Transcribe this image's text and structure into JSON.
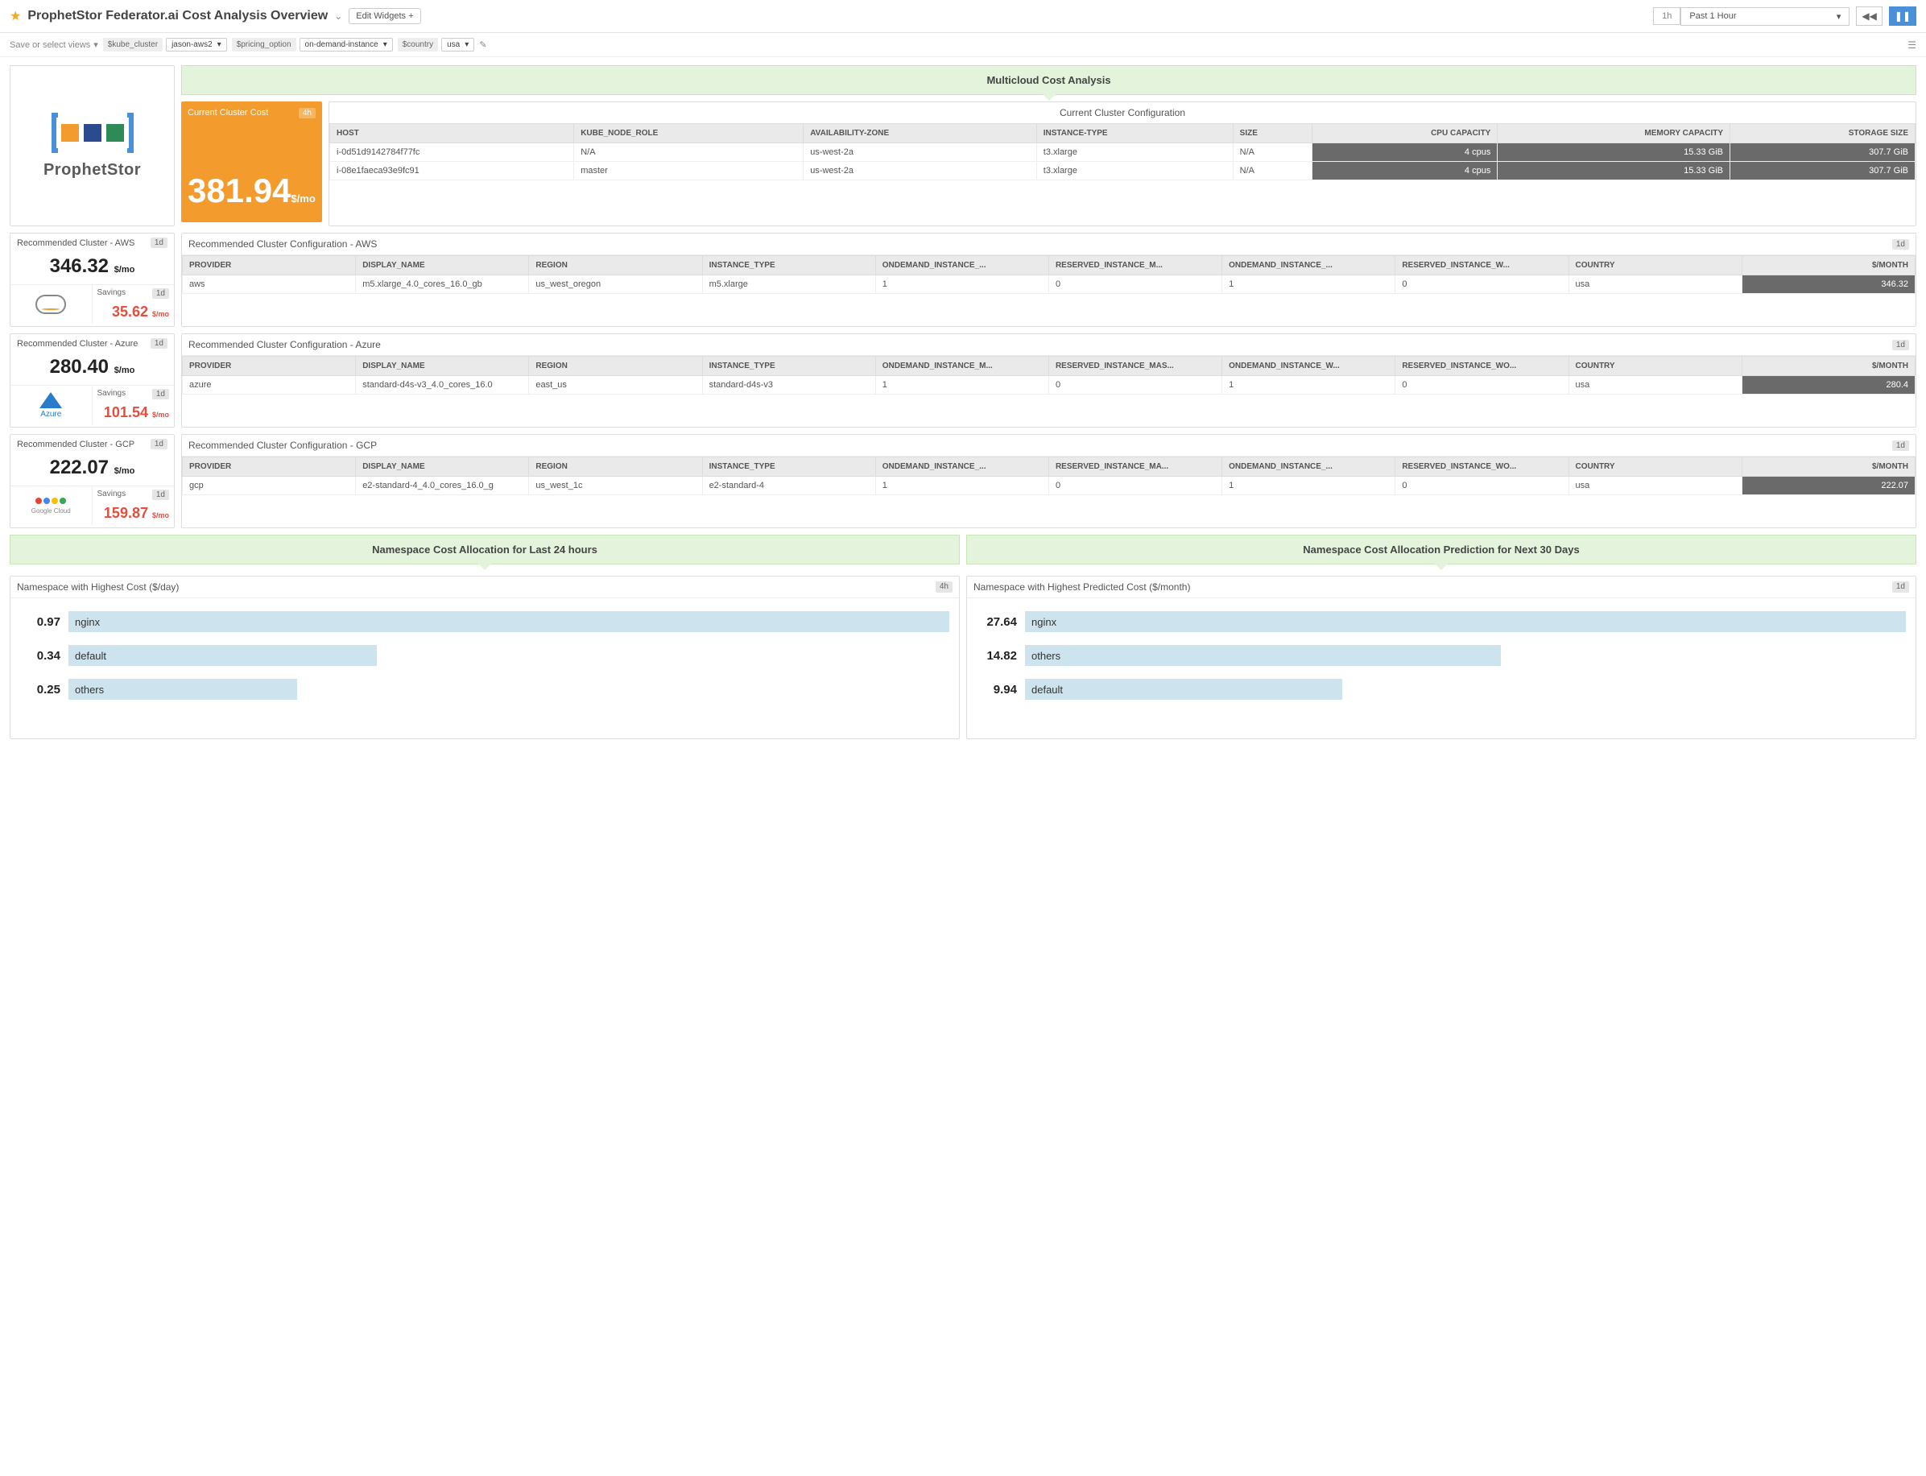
{
  "header": {
    "title": "ProphetStor Federator.ai Cost Analysis Overview",
    "edit_widgets": "Edit Widgets",
    "time_short": "1h",
    "time_label": "Past 1 Hour"
  },
  "subbar": {
    "views": "Save or select views",
    "vars": [
      {
        "name": "$kube_cluster",
        "value": "jason-aws2"
      },
      {
        "name": "$pricing_option",
        "value": "on-demand-instance"
      },
      {
        "name": "$country",
        "value": "usa"
      }
    ]
  },
  "logo_text": "ProphetStor",
  "multicloud_banner": "Multicloud Cost Analysis",
  "current_cost": {
    "title": "Current Cluster Cost",
    "badge": "4h",
    "value": "381.94",
    "unit": "$/mo"
  },
  "current_config": {
    "title": "Current Cluster Configuration",
    "headers": [
      "HOST",
      "KUBE_NODE_ROLE",
      "AVAILABILITY-ZONE",
      "INSTANCE-TYPE",
      "SIZE",
      "CPU CAPACITY",
      "MEMORY CAPACITY",
      "STORAGE SIZE"
    ],
    "rows": [
      [
        "i-0d51d9142784f77fc",
        "N/A",
        "us-west-2a",
        "t3.xlarge",
        "N/A",
        "4 cpus",
        "15.33 GiB",
        "307.7 GiB"
      ],
      [
        "i-08e1faeca93e9fc91",
        "master",
        "us-west-2a",
        "t3.xlarge",
        "N/A",
        "4 cpus",
        "15.33 GiB",
        "307.7 GiB"
      ]
    ]
  },
  "recs": [
    {
      "provider": "AWS",
      "left_title": "Recommended Cluster - AWS",
      "badge": "1d",
      "value": "346.32",
      "unit": "$/mo",
      "savings_label": "Savings",
      "savings_badge": "1d",
      "savings": "35.62",
      "savings_unit": "$/mo",
      "icon_label": "aws",
      "table_title": "Recommended Cluster Configuration - AWS",
      "table_badge": "1d",
      "headers": [
        "PROVIDER",
        "DISPLAY_NAME",
        "REGION",
        "INSTANCE_TYPE",
        "ONDEMAND_INSTANCE_...",
        "RESERVED_INSTANCE_M...",
        "ONDEMAND_INSTANCE_...",
        "RESERVED_INSTANCE_W...",
        "COUNTRY",
        "$/MONTH"
      ],
      "row": [
        "aws",
        "m5.xlarge_4.0_cores_16.0_gb",
        "us_west_oregon",
        "m5.xlarge",
        "1",
        "0",
        "1",
        "0",
        "usa",
        "346.32"
      ]
    },
    {
      "provider": "Azure",
      "left_title": "Recommended Cluster - Azure",
      "badge": "1d",
      "value": "280.40",
      "unit": "$/mo",
      "savings_label": "Savings",
      "savings_badge": "1d",
      "savings": "101.54",
      "savings_unit": "$/mo",
      "icon_label": "Azure",
      "table_title": "Recommended Cluster Configuration - Azure",
      "table_badge": "1d",
      "headers": [
        "PROVIDER",
        "DISPLAY_NAME",
        "REGION",
        "INSTANCE_TYPE",
        "ONDEMAND_INSTANCE_M...",
        "RESERVED_INSTANCE_MAS...",
        "ONDEMAND_INSTANCE_W...",
        "RESERVED_INSTANCE_WO...",
        "COUNTRY",
        "$/MONTH"
      ],
      "row": [
        "azure",
        "standard-d4s-v3_4.0_cores_16.0",
        "east_us",
        "standard-d4s-v3",
        "1",
        "0",
        "1",
        "0",
        "usa",
        "280.4"
      ]
    },
    {
      "provider": "GCP",
      "left_title": "Recommended Cluster - GCP",
      "badge": "1d",
      "value": "222.07",
      "unit": "$/mo",
      "savings_label": "Savings",
      "savings_badge": "1d",
      "savings": "159.87",
      "savings_unit": "$/mo",
      "icon_label": "Google Cloud",
      "table_title": "Recommended Cluster Configuration - GCP",
      "table_badge": "1d",
      "headers": [
        "PROVIDER",
        "DISPLAY_NAME",
        "REGION",
        "INSTANCE_TYPE",
        "ONDEMAND_INSTANCE_...",
        "RESERVED_INSTANCE_MA...",
        "ONDEMAND_INSTANCE_...",
        "RESERVED_INSTANCE_WO...",
        "COUNTRY",
        "$/MONTH"
      ],
      "row": [
        "gcp",
        "e2-standard-4_4.0_cores_16.0_g",
        "us_west_1c",
        "e2-standard-4",
        "1",
        "0",
        "1",
        "0",
        "usa",
        "222.07"
      ]
    }
  ],
  "ns_24h": {
    "banner": "Namespace Cost Allocation for Last 24 hours",
    "title": "Namespace with Highest Cost ($/day)",
    "badge": "4h",
    "bars": [
      {
        "value": "0.97",
        "label": "nginx",
        "pct": 100
      },
      {
        "value": "0.34",
        "label": "default",
        "pct": 35
      },
      {
        "value": "0.25",
        "label": "others",
        "pct": 26
      }
    ]
  },
  "ns_30d": {
    "banner": "Namespace Cost Allocation Prediction for Next 30 Days",
    "title": "Namespace with Highest Predicted Cost ($/month)",
    "badge": "1d",
    "bars": [
      {
        "value": "27.64",
        "label": "nginx",
        "pct": 100
      },
      {
        "value": "14.82",
        "label": "others",
        "pct": 54
      },
      {
        "value": "9.94",
        "label": "default",
        "pct": 36
      }
    ]
  },
  "chart_data": [
    {
      "type": "bar",
      "title": "Namespace with Highest Cost ($/day)",
      "xlabel": "$/day",
      "categories": [
        "nginx",
        "default",
        "others"
      ],
      "values": [
        0.97,
        0.34,
        0.25
      ]
    },
    {
      "type": "bar",
      "title": "Namespace with Highest Predicted Cost ($/month)",
      "xlabel": "$/month",
      "categories": [
        "nginx",
        "others",
        "default"
      ],
      "values": [
        27.64,
        14.82,
        9.94
      ]
    }
  ]
}
